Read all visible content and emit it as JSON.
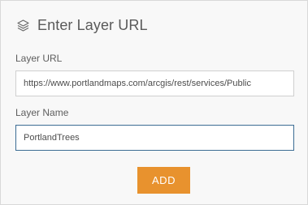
{
  "panel": {
    "title": "Enter Layer URL",
    "title_icon": "layers-icon"
  },
  "form": {
    "layer_url_label": "Layer URL",
    "layer_url_value": "https://www.portlandmaps.com/arcgis/rest/services/Public",
    "layer_name_label": "Layer Name",
    "layer_name_value": "PortlandTrees",
    "add_button_label": "ADD"
  },
  "colors": {
    "accent": "#e8922e",
    "focus_border": "#3c6c94",
    "text": "#5a5a5a"
  }
}
